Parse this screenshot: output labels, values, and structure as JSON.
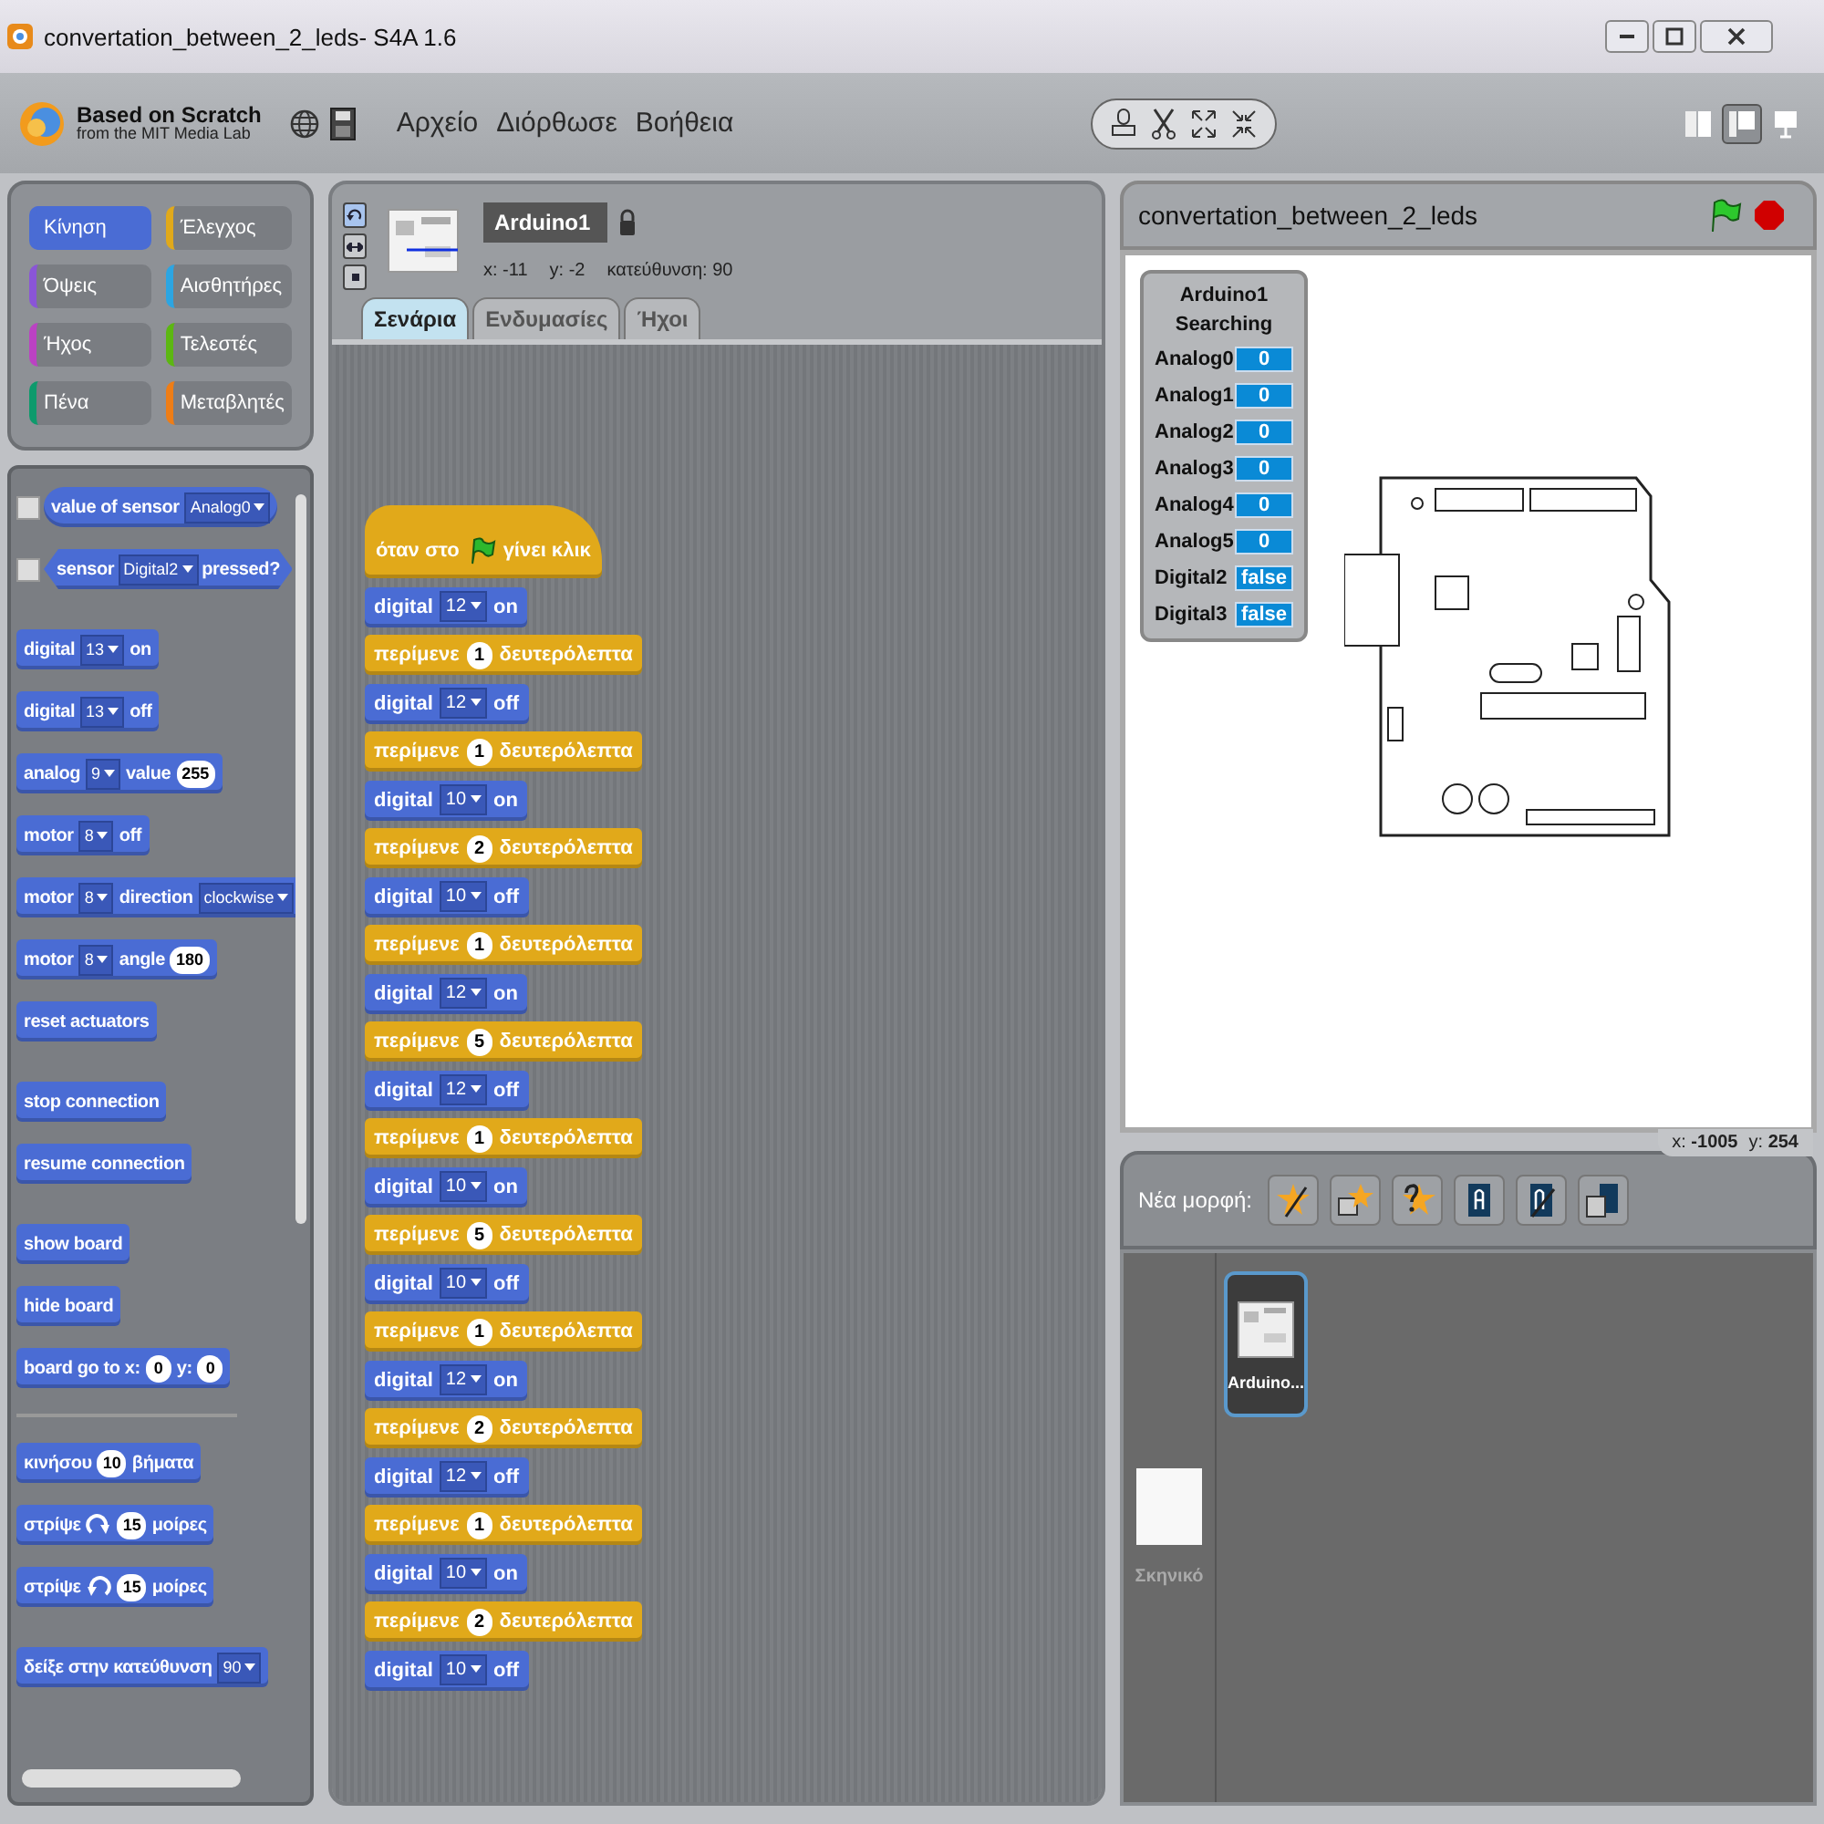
{
  "window": {
    "title": "convertation_between_2_leds- S4A 1.6"
  },
  "logo": {
    "title": "Based on Scratch",
    "subtitle": "from the MIT Media Lab"
  },
  "menu": [
    {
      "label": "Αρχείο"
    },
    {
      "label": "Διόρθωσε"
    },
    {
      "label": "Βοήθεια"
    }
  ],
  "view_modes": [
    {
      "kind": "small",
      "selected": false
    },
    {
      "kind": "normal",
      "selected": true
    },
    {
      "kind": "present",
      "selected": false
    }
  ],
  "categories": [
    {
      "label": "Κίνηση",
      "color": "#4a6cd4",
      "selected": true
    },
    {
      "label": "Έλεγχος",
      "color": "#e1a91a",
      "selected": false
    },
    {
      "label": "Όψεις",
      "color": "#8a55d7",
      "selected": false
    },
    {
      "label": "Αισθητήρες",
      "color": "#2ca5e2",
      "selected": false
    },
    {
      "label": "Ήχος",
      "color": "#bb42c3",
      "selected": false
    },
    {
      "label": "Τελεστές",
      "color": "#5cb712",
      "selected": false
    },
    {
      "label": "Πένα",
      "color": "#0e9a6c",
      "selected": false
    },
    {
      "label": "Μεταβλητές",
      "color": "#ee7d16",
      "selected": false
    }
  ],
  "palette": {
    "groups": [
      {
        "ruled": false,
        "blocks": [
          {
            "kind": "reporter",
            "checked": false,
            "parts": [
              {
                "kind": "label",
                "text": "value of sensor"
              },
              {
                "kind": "dropdown",
                "text": "Analog0"
              }
            ]
          },
          {
            "kind": "predicate",
            "checked": false,
            "parts": [
              {
                "kind": "label",
                "text": "sensor"
              },
              {
                "kind": "dropdown",
                "text": "Digital2"
              },
              {
                "kind": "label",
                "text": "pressed?"
              }
            ]
          }
        ]
      },
      {
        "ruled": false,
        "blocks": [
          {
            "kind": "command",
            "parts": [
              {
                "kind": "label",
                "text": "digital"
              },
              {
                "kind": "dropdown",
                "text": "13"
              },
              {
                "kind": "label",
                "text": "on"
              }
            ]
          },
          {
            "kind": "command",
            "parts": [
              {
                "kind": "label",
                "text": "digital"
              },
              {
                "kind": "dropdown",
                "text": "13"
              },
              {
                "kind": "label",
                "text": "off"
              }
            ]
          },
          {
            "kind": "command",
            "parts": [
              {
                "kind": "label",
                "text": "analog"
              },
              {
                "kind": "dropdown",
                "text": "9"
              },
              {
                "kind": "label",
                "text": "value"
              },
              {
                "kind": "number",
                "text": "255"
              }
            ]
          },
          {
            "kind": "command",
            "parts": [
              {
                "kind": "label",
                "text": "motor"
              },
              {
                "kind": "dropdown",
                "text": "8"
              },
              {
                "kind": "label",
                "text": "off"
              }
            ]
          },
          {
            "kind": "command",
            "parts": [
              {
                "kind": "label",
                "text": "motor"
              },
              {
                "kind": "dropdown",
                "text": "8"
              },
              {
                "kind": "label",
                "text": "direction"
              },
              {
                "kind": "dropdown",
                "text": "clockwise"
              }
            ]
          },
          {
            "kind": "command",
            "parts": [
              {
                "kind": "label",
                "text": "motor"
              },
              {
                "kind": "dropdown",
                "text": "8"
              },
              {
                "kind": "label",
                "text": "angle"
              },
              {
                "kind": "number",
                "text": "180"
              }
            ]
          },
          {
            "kind": "command",
            "parts": [
              {
                "kind": "label",
                "text": "reset actuators"
              }
            ]
          }
        ]
      },
      {
        "ruled": false,
        "blocks": [
          {
            "kind": "command",
            "parts": [
              {
                "kind": "label",
                "text": "stop connection"
              }
            ]
          },
          {
            "kind": "command",
            "parts": [
              {
                "kind": "label",
                "text": "resume connection"
              }
            ]
          }
        ]
      },
      {
        "ruled": false,
        "blocks": [
          {
            "kind": "command",
            "parts": [
              {
                "kind": "label",
                "text": "show board"
              }
            ]
          },
          {
            "kind": "command",
            "parts": [
              {
                "kind": "label",
                "text": "hide board"
              }
            ]
          },
          {
            "kind": "command",
            "parts": [
              {
                "kind": "label",
                "text": "board go to x:"
              },
              {
                "kind": "number",
                "text": "0"
              },
              {
                "kind": "label",
                "text": "y:"
              },
              {
                "kind": "number",
                "text": "0"
              }
            ]
          }
        ]
      },
      {
        "ruled": true,
        "blocks": [
          {
            "kind": "command",
            "parts": [
              {
                "kind": "label",
                "text": "κινήσου"
              },
              {
                "kind": "number",
                "text": "10"
              },
              {
                "kind": "label",
                "text": "βήματα"
              }
            ]
          },
          {
            "kind": "command",
            "parts": [
              {
                "kind": "label",
                "text": "στρίψε"
              },
              {
                "kind": "rotate_cw"
              },
              {
                "kind": "number",
                "text": "15"
              },
              {
                "kind": "label",
                "text": "μοίρες"
              }
            ]
          },
          {
            "kind": "command",
            "parts": [
              {
                "kind": "label",
                "text": "στρίψε"
              },
              {
                "kind": "rotate_ccw"
              },
              {
                "kind": "number",
                "text": "15"
              },
              {
                "kind": "label",
                "text": "μοίρες"
              }
            ]
          }
        ]
      },
      {
        "ruled": false,
        "blocks": [
          {
            "kind": "command",
            "parts": [
              {
                "kind": "label",
                "text": "δείξε στην κατεύθυνση"
              },
              {
                "kind": "dropdown",
                "text": "90"
              }
            ]
          }
        ]
      }
    ]
  },
  "sprite": {
    "name": "Arduino1",
    "x": "x: -11",
    "y": "y: -2",
    "direction": "κατεύθυνση: 90",
    "rotation_styles": [
      {
        "kind": "rotate",
        "selected": true
      },
      {
        "kind": "flip",
        "selected": false
      },
      {
        "kind": "none",
        "selected": false
      }
    ]
  },
  "tabs": [
    {
      "label": "Σενάρια",
      "selected": true
    },
    {
      "label": "Ενδυμασίες",
      "selected": false
    },
    {
      "label": "Ήχοι",
      "selected": false
    }
  ],
  "script": [
    {
      "kind": "hat",
      "parts": [
        {
          "kind": "label",
          "text": "όταν στο"
        },
        {
          "kind": "flag"
        },
        {
          "kind": "label",
          "text": "γίνει κλικ"
        }
      ]
    },
    {
      "kind": "command",
      "parts": [
        {
          "kind": "label",
          "text": "digital"
        },
        {
          "kind": "dropdown",
          "text": "12"
        },
        {
          "kind": "label",
          "text": "on"
        }
      ]
    },
    {
      "kind": "control",
      "parts": [
        {
          "kind": "label",
          "text": "περίμενε"
        },
        {
          "kind": "number",
          "text": "1"
        },
        {
          "kind": "label",
          "text": "δευτερόλεπτα"
        }
      ]
    },
    {
      "kind": "command",
      "parts": [
        {
          "kind": "label",
          "text": "digital"
        },
        {
          "kind": "dropdown",
          "text": "12"
        },
        {
          "kind": "label",
          "text": "off"
        }
      ]
    },
    {
      "kind": "control",
      "parts": [
        {
          "kind": "label",
          "text": "περίμενε"
        },
        {
          "kind": "number",
          "text": "1"
        },
        {
          "kind": "label",
          "text": "δευτερόλεπτα"
        }
      ]
    },
    {
      "kind": "command",
      "parts": [
        {
          "kind": "label",
          "text": "digital"
        },
        {
          "kind": "dropdown",
          "text": "10"
        },
        {
          "kind": "label",
          "text": "on"
        }
      ]
    },
    {
      "kind": "control",
      "parts": [
        {
          "kind": "label",
          "text": "περίμενε"
        },
        {
          "kind": "number",
          "text": "2"
        },
        {
          "kind": "label",
          "text": "δευτερόλεπτα"
        }
      ]
    },
    {
      "kind": "command",
      "parts": [
        {
          "kind": "label",
          "text": "digital"
        },
        {
          "kind": "dropdown",
          "text": "10"
        },
        {
          "kind": "label",
          "text": "off"
        }
      ]
    },
    {
      "kind": "control",
      "parts": [
        {
          "kind": "label",
          "text": "περίμενε"
        },
        {
          "kind": "number",
          "text": "1"
        },
        {
          "kind": "label",
          "text": "δευτερόλεπτα"
        }
      ]
    },
    {
      "kind": "command",
      "parts": [
        {
          "kind": "label",
          "text": "digital"
        },
        {
          "kind": "dropdown",
          "text": "12"
        },
        {
          "kind": "label",
          "text": "on"
        }
      ]
    },
    {
      "kind": "control",
      "parts": [
        {
          "kind": "label",
          "text": "περίμενε"
        },
        {
          "kind": "number",
          "text": "5"
        },
        {
          "kind": "label",
          "text": "δευτερόλεπτα"
        }
      ]
    },
    {
      "kind": "command",
      "parts": [
        {
          "kind": "label",
          "text": "digital"
        },
        {
          "kind": "dropdown",
          "text": "12"
        },
        {
          "kind": "label",
          "text": "off"
        }
      ]
    },
    {
      "kind": "control",
      "parts": [
        {
          "kind": "label",
          "text": "περίμενε"
        },
        {
          "kind": "number",
          "text": "1"
        },
        {
          "kind": "label",
          "text": "δευτερόλεπτα"
        }
      ]
    },
    {
      "kind": "command",
      "parts": [
        {
          "kind": "label",
          "text": "digital"
        },
        {
          "kind": "dropdown",
          "text": "10"
        },
        {
          "kind": "label",
          "text": "on"
        }
      ]
    },
    {
      "kind": "control",
      "parts": [
        {
          "kind": "label",
          "text": "περίμενε"
        },
        {
          "kind": "number",
          "text": "5"
        },
        {
          "kind": "label",
          "text": "δευτερόλεπτα"
        }
      ]
    },
    {
      "kind": "command",
      "parts": [
        {
          "kind": "label",
          "text": "digital"
        },
        {
          "kind": "dropdown",
          "text": "10"
        },
        {
          "kind": "label",
          "text": "off"
        }
      ]
    },
    {
      "kind": "control",
      "parts": [
        {
          "kind": "label",
          "text": "περίμενε"
        },
        {
          "kind": "number",
          "text": "1"
        },
        {
          "kind": "label",
          "text": "δευτερόλεπτα"
        }
      ]
    },
    {
      "kind": "command",
      "parts": [
        {
          "kind": "label",
          "text": "digital"
        },
        {
          "kind": "dropdown",
          "text": "12"
        },
        {
          "kind": "label",
          "text": "on"
        }
      ]
    },
    {
      "kind": "control",
      "parts": [
        {
          "kind": "label",
          "text": "περίμενε"
        },
        {
          "kind": "number",
          "text": "2"
        },
        {
          "kind": "label",
          "text": "δευτερόλεπτα"
        }
      ]
    },
    {
      "kind": "command",
      "parts": [
        {
          "kind": "label",
          "text": "digital"
        },
        {
          "kind": "dropdown",
          "text": "12"
        },
        {
          "kind": "label",
          "text": "off"
        }
      ]
    },
    {
      "kind": "control",
      "parts": [
        {
          "kind": "label",
          "text": "περίμενε"
        },
        {
          "kind": "number",
          "text": "1"
        },
        {
          "kind": "label",
          "text": "δευτερόλεπτα"
        }
      ]
    },
    {
      "kind": "command",
      "parts": [
        {
          "kind": "label",
          "text": "digital"
        },
        {
          "kind": "dropdown",
          "text": "10"
        },
        {
          "kind": "label",
          "text": "on"
        }
      ]
    },
    {
      "kind": "control",
      "parts": [
        {
          "kind": "label",
          "text": "περίμενε"
        },
        {
          "kind": "number",
          "text": "2"
        },
        {
          "kind": "label",
          "text": "δευτερόλεπτα"
        }
      ]
    },
    {
      "kind": "command",
      "parts": [
        {
          "kind": "label",
          "text": "digital"
        },
        {
          "kind": "dropdown",
          "text": "10"
        },
        {
          "kind": "label",
          "text": "off"
        }
      ]
    }
  ],
  "stage": {
    "title": "convertation_between_2_leds",
    "sensor_panel": {
      "title": "Arduino1",
      "status": "Searching",
      "rows": [
        {
          "label": "Analog0",
          "value": "0"
        },
        {
          "label": "Analog1",
          "value": "0"
        },
        {
          "label": "Analog2",
          "value": "0"
        },
        {
          "label": "Analog3",
          "value": "0"
        },
        {
          "label": "Analog4",
          "value": "0"
        },
        {
          "label": "Analog5",
          "value": "0"
        },
        {
          "label": "Digital2",
          "value": "false"
        },
        {
          "label": "Digital3",
          "value": "false"
        }
      ]
    },
    "mouse_x": "x: **-1005**",
    "mouse_y": "y: **254**"
  },
  "new_sprite": {
    "label": "Νέα μορφή:"
  },
  "sprites": [
    {
      "name": "Arduino...",
      "selected": true
    }
  ],
  "backdrop": {
    "label": "Σκηνικό"
  }
}
